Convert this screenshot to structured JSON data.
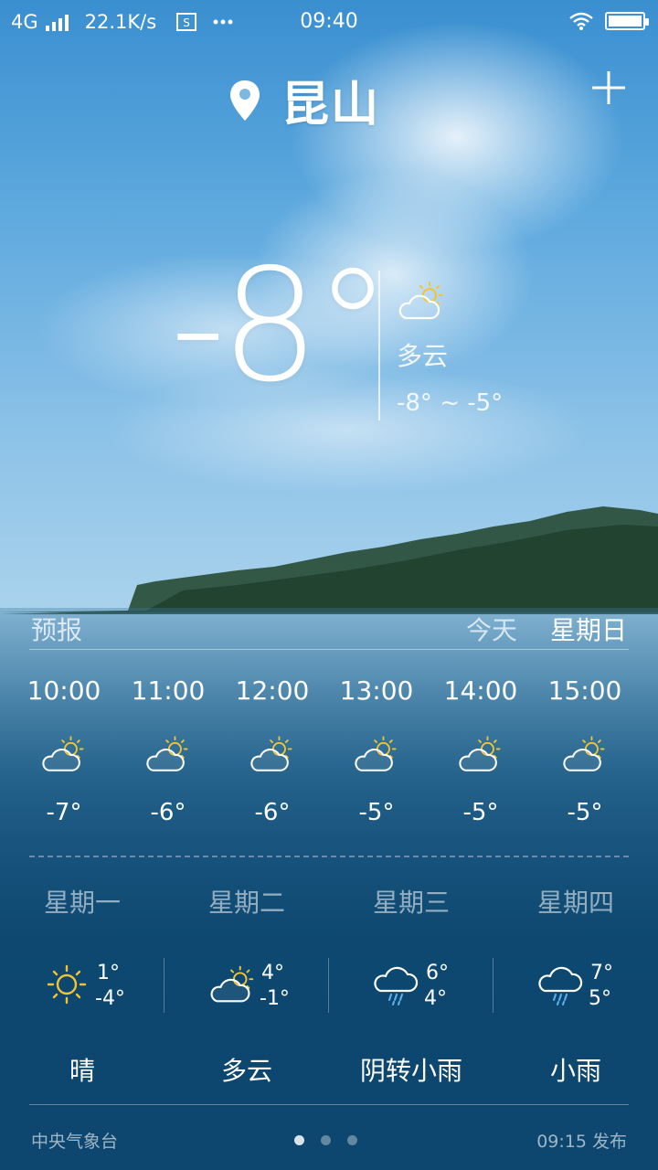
{
  "status_bar": {
    "network": "4G",
    "speed": "22.1K/s",
    "time": "09:40",
    "icons": [
      "signal-icon",
      "screenshot-icon",
      "more-icon",
      "wifi-icon",
      "battery-icon"
    ]
  },
  "header": {
    "city": "昆山",
    "location_icon": "location-pin-icon",
    "add_icon": "add-icon"
  },
  "current": {
    "temperature": "-8°",
    "condition": "多云",
    "range": "-8° ~ -5°",
    "icon": "partly-cloudy-icon"
  },
  "forecast": {
    "title": "预报",
    "tab_today": "今天",
    "tab_day": "星期日",
    "hourly": [
      {
        "time": "10:00",
        "temp": "-7°",
        "icon": "partly-cloudy-icon"
      },
      {
        "time": "11:00",
        "temp": "-6°",
        "icon": "partly-cloudy-icon"
      },
      {
        "time": "12:00",
        "temp": "-6°",
        "icon": "partly-cloudy-icon"
      },
      {
        "time": "13:00",
        "temp": "-5°",
        "icon": "partly-cloudy-icon"
      },
      {
        "time": "14:00",
        "temp": "-5°",
        "icon": "partly-cloudy-icon"
      },
      {
        "time": "15:00",
        "temp": "-5°",
        "icon": "partly-cloudy-icon"
      }
    ],
    "daily": [
      {
        "day": "星期一",
        "hi": "1°",
        "lo": "-4°",
        "desc": "晴",
        "icon": "sun-icon"
      },
      {
        "day": "星期二",
        "hi": "4°",
        "lo": "-1°",
        "desc": "多云",
        "icon": "partly-cloudy-icon"
      },
      {
        "day": "星期三",
        "hi": "6°",
        "lo": "4°",
        "desc": "阴转小雨",
        "icon": "rain-cloud-icon"
      },
      {
        "day": "星期四",
        "hi": "7°",
        "lo": "5°",
        "desc": "小雨",
        "icon": "rain-cloud-icon"
      }
    ]
  },
  "footer": {
    "source": "中央气象台",
    "published": "09:15 发布",
    "pages": 3,
    "active_page": 1
  },
  "colors": {
    "sun": "#f4c430",
    "text": "#ffffff",
    "lake": "#0d476f"
  }
}
